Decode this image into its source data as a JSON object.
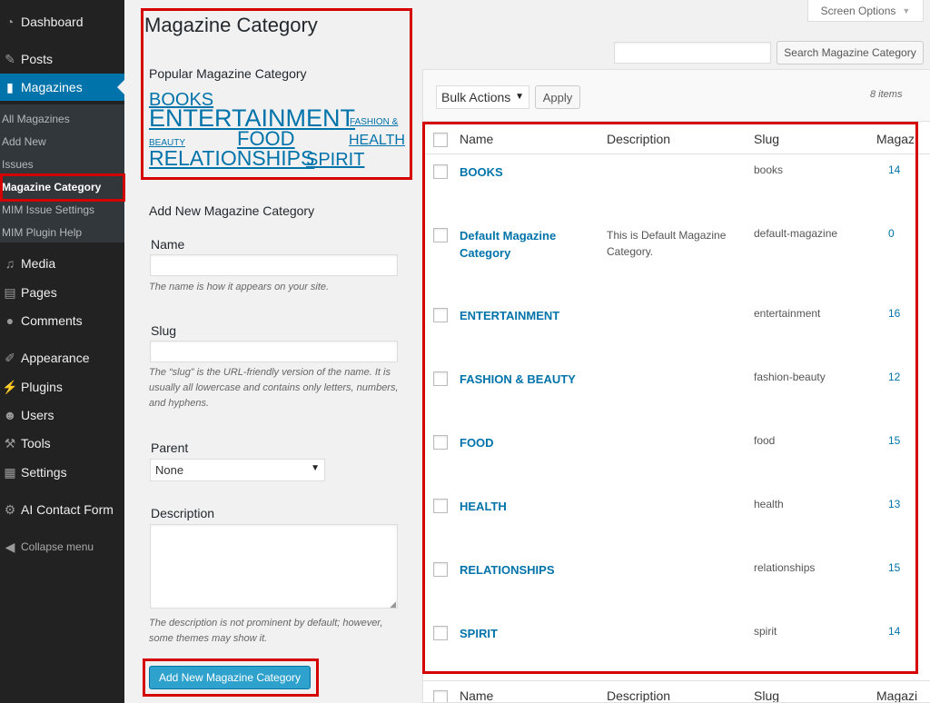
{
  "sidebar": {
    "menu": [
      {
        "label": "Dashboard",
        "icon": "dashboard-icon"
      },
      {
        "label": "Posts",
        "icon": "pin-icon"
      },
      {
        "label": "Magazines",
        "icon": "book-icon"
      },
      {
        "label": "Media",
        "icon": "media-icon"
      },
      {
        "label": "Pages",
        "icon": "pages-icon"
      },
      {
        "label": "Comments",
        "icon": "comment-icon"
      },
      {
        "label": "Appearance",
        "icon": "brush-icon"
      },
      {
        "label": "Plugins",
        "icon": "plug-icon"
      },
      {
        "label": "Users",
        "icon": "user-icon"
      },
      {
        "label": "Tools",
        "icon": "wrench-icon"
      },
      {
        "label": "Settings",
        "icon": "settings-icon"
      },
      {
        "label": "AI Contact Form",
        "icon": "gear-icon"
      }
    ],
    "submenu": [
      "All Magazines",
      "Add New",
      "Issues",
      "Magazine Category",
      "MIM Issue Settings",
      "MIM Plugin Help"
    ],
    "collapse_label": "Collapse menu",
    "colors": {
      "bg": "#222222",
      "active": "#0073aa",
      "submenu_bg": "#32373c"
    }
  },
  "page": {
    "title": "Magazine Category"
  },
  "popular": {
    "title": "Popular Magazine Category",
    "tags": [
      "BOOKS",
      "ENTERTAINMENT",
      "FASHION & BEAUTY",
      "FOOD",
      "HEALTH",
      "RELATIONSHIPS",
      "SPIRIT"
    ]
  },
  "form": {
    "heading": "Add New Magazine Category",
    "name_label": "Name",
    "name_help": "The name is how it appears on your site.",
    "slug_label": "Slug",
    "slug_help": "The “slug” is the URL-friendly version of the name. It is usually all lowercase and contains only letters, numbers, and hyphens.",
    "parent_label": "Parent",
    "parent_value": "None",
    "description_label": "Description",
    "description_help": "The description is not prominent by default; however, some themes may show it.",
    "submit_label": "Add New Magazine Category"
  },
  "toolbar": {
    "screen_options": "Screen Options",
    "search_button": "Search Magazine Category",
    "bulk_actions": "Bulk Actions",
    "apply": "Apply",
    "items_count": "8 items"
  },
  "table": {
    "columns": [
      "Name",
      "Description",
      "Slug",
      "Magazi"
    ],
    "rows": [
      {
        "name": "BOOKS",
        "description": "",
        "slug": "books",
        "count": "14"
      },
      {
        "name": "Default Magazine Category",
        "description": "This is Default Magazine Category.",
        "slug": "default-magazine",
        "count": "0"
      },
      {
        "name": "ENTERTAINMENT",
        "description": "",
        "slug": "entertainment",
        "count": "16"
      },
      {
        "name": "FASHION & BEAUTY",
        "description": "",
        "slug": "fashion-beauty",
        "count": "12"
      },
      {
        "name": "FOOD",
        "description": "",
        "slug": "food",
        "count": "15"
      },
      {
        "name": "HEALTH",
        "description": "",
        "slug": "health",
        "count": "13"
      },
      {
        "name": "RELATIONSHIPS",
        "description": "",
        "slug": "relationships",
        "count": "15"
      },
      {
        "name": "SPIRIT",
        "description": "",
        "slug": "spirit",
        "count": "14"
      }
    ]
  },
  "colors": {
    "link": "#0073aa",
    "annotation": "#d40000",
    "primary_button": "#2ea2cc"
  }
}
